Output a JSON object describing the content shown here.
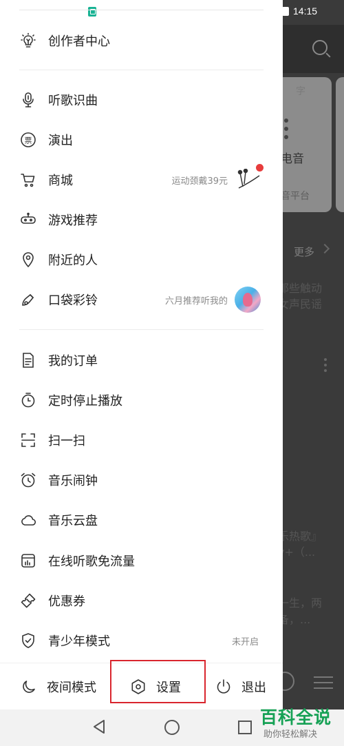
{
  "status_bar": {
    "time": "14:15"
  },
  "background": {
    "card_text_1": "电音",
    "card_text_2": "音平台",
    "card_top_text": "字",
    "more_label": "更多",
    "line_1": "那些触动",
    "line_2": "女声民谣",
    "line_3": "乐热歌』",
    "line_4": "v+（...",
    "line_5": "一生，两",
    "line_6": "备，..."
  },
  "drawer": {
    "section1": [
      {
        "label": "创作者中心",
        "icon": "lightbulb-icon"
      }
    ],
    "section2": [
      {
        "label": "听歌识曲",
        "icon": "music-recognize-icon"
      },
      {
        "label": "演出",
        "icon": "ticket-icon"
      },
      {
        "label": "商城",
        "icon": "cart-icon",
        "side": "运动颈戴39元"
      },
      {
        "label": "游戏推荐",
        "icon": "gamepad-icon"
      },
      {
        "label": "附近的人",
        "icon": "location-icon"
      },
      {
        "label": "口袋彩铃",
        "icon": "ringtone-icon",
        "side": "六月推荐听我的"
      }
    ],
    "section3": [
      {
        "label": "我的订单",
        "icon": "order-icon"
      },
      {
        "label": "定时停止播放",
        "icon": "timer-icon"
      },
      {
        "label": "扫一扫",
        "icon": "scan-icon"
      },
      {
        "label": "音乐闹钟",
        "icon": "alarm-icon"
      },
      {
        "label": "音乐云盘",
        "icon": "cloud-icon"
      },
      {
        "label": "在线听歌免流量",
        "icon": "data-plan-icon"
      },
      {
        "label": "优惠券",
        "icon": "coupon-icon"
      },
      {
        "label": "青少年模式",
        "icon": "shield-icon",
        "side": "未开启"
      }
    ]
  },
  "bottom_bar": {
    "night_mode": "夜间模式",
    "settings": "设置",
    "logout": "退出"
  },
  "watermark": {
    "title": "百科全说",
    "subtitle": "助你轻松解决"
  },
  "colors": {
    "highlight": "#d9252d",
    "badge": "#e73c3c",
    "watermark": "#16a155"
  }
}
